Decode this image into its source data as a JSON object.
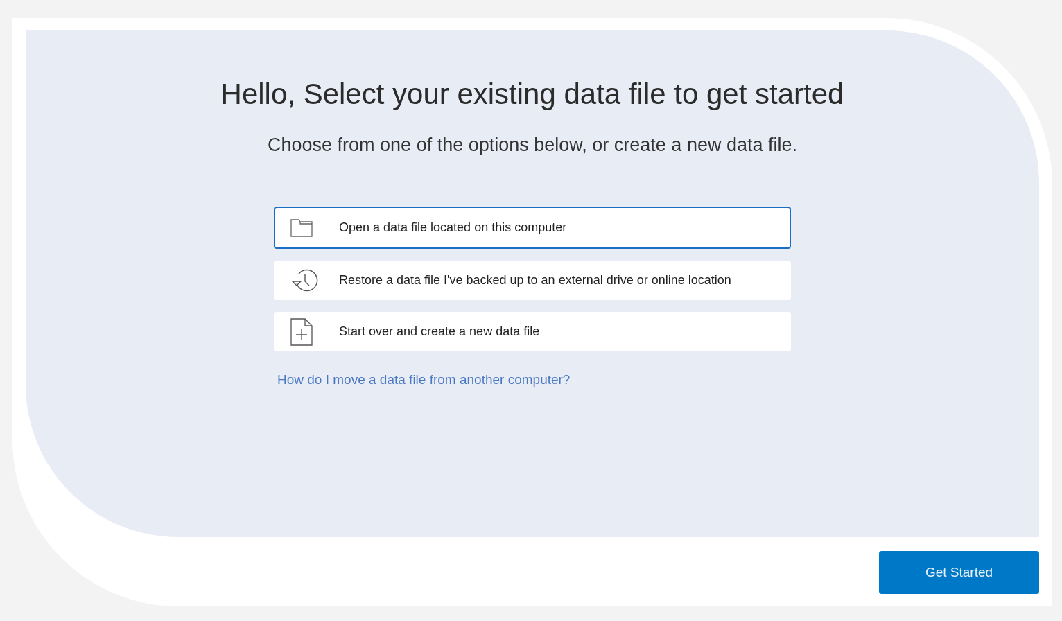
{
  "heading": "Hello, Select your existing data file to get started",
  "subheading": "Choose from one of the options below, or create a new data file.",
  "options": [
    {
      "kind": "folder",
      "label": "Open a data file located on this computer",
      "selected": true
    },
    {
      "kind": "history",
      "label": "Restore a data file I've backed up to an external drive or online location",
      "selected": false
    },
    {
      "kind": "new-file",
      "label": "Start over and create a new data file",
      "selected": false
    }
  ],
  "help_link": "How do I move a data file from another computer?",
  "primary_button": "Get Started"
}
